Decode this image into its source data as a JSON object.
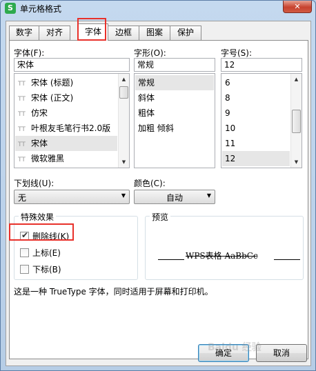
{
  "window": {
    "title": "单元格格式",
    "app_icon": "S",
    "close_glyph": "✕"
  },
  "tabs": [
    {
      "label": "数字",
      "active": false
    },
    {
      "label": "对齐",
      "active": false
    },
    {
      "label": "字体",
      "active": true
    },
    {
      "label": "边框",
      "active": false
    },
    {
      "label": "图案",
      "active": false
    },
    {
      "label": "保护",
      "active": false
    }
  ],
  "font": {
    "label": "字体(F):",
    "value": "宋体",
    "items": [
      "宋体 (标题)",
      "宋体 (正文)",
      "仿宋",
      "叶根友毛笔行书2.0版",
      "宋体",
      "微软雅黑"
    ],
    "selected": "宋体",
    "font_type_icon": "TT"
  },
  "style": {
    "label": "字形(O):",
    "value": "常规",
    "items": [
      "常规",
      "斜体",
      "粗体",
      "加粗 倾斜"
    ],
    "selected": "常规"
  },
  "size": {
    "label": "字号(S):",
    "value": "12",
    "items": [
      "6",
      "8",
      "9",
      "10",
      "11",
      "12"
    ],
    "selected": "12"
  },
  "underline": {
    "label": "下划线(U):",
    "value": "无"
  },
  "color": {
    "label": "颜色(C):",
    "value": "自动"
  },
  "effects": {
    "title": "特殊效果",
    "strikethrough": {
      "label": "删除线(K)",
      "checked": true
    },
    "superscript": {
      "label": "上标(E)",
      "checked": false
    },
    "subscript": {
      "label": "下标(B)",
      "checked": false
    }
  },
  "preview": {
    "title": "预览",
    "sample": "WPS表格  AaBbCc"
  },
  "info_text": "这是一种 TrueType 字体，同时适用于屏幕和打印机。",
  "buttons": {
    "ok": "确定",
    "cancel": "取消"
  },
  "watermark": "Baidu 经验",
  "colors": {
    "highlight": "#e8302a",
    "app_icon": "#2eaa4e",
    "close": "#c7432f",
    "selection": "#e6e6e6"
  }
}
